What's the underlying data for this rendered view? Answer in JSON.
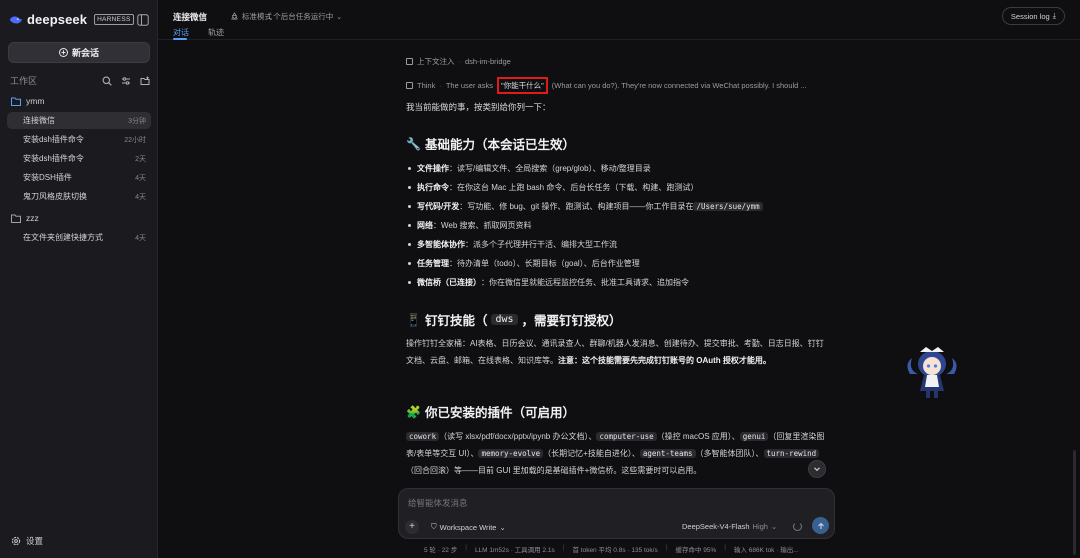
{
  "sidebar": {
    "brand": "deepseek",
    "badge": "HARNESS",
    "new_chat": "新会话",
    "workspace_title": "工作区",
    "folders": [
      {
        "name": "ymm",
        "threads": [
          {
            "title": "连接微信",
            "time": "3分钟",
            "active": true
          },
          {
            "title": "安装dsh插件命令",
            "time": "22小时"
          },
          {
            "title": "安装dsh插件命令",
            "time": "2天"
          },
          {
            "title": "安装DSH插件",
            "time": "4天"
          },
          {
            "title": "鬼刀风格皮肤切换",
            "time": "4天"
          }
        ]
      },
      {
        "name": "zzz",
        "threads": [
          {
            "title": "在文件夹创建快捷方式",
            "time": "4天"
          }
        ]
      }
    ],
    "settings": "设置"
  },
  "header": {
    "title": "连接微信",
    "mode": "标准模式",
    "tasks": "1 个后台任务运行中",
    "tabs": [
      "对话",
      "轨迹"
    ],
    "session_log": "Session log"
  },
  "conversation": {
    "context_label": "上下文注入",
    "context_value": "dsh-im-bridge",
    "think_label": "Think",
    "think_prefix": "The user asks",
    "think_quote": "\"你能干什么\"",
    "think_rest": "(What can you do?). They're now connected via WeChat possibly. I should ...",
    "intro": "我当前能做的事，按类别给你列一下：",
    "section1": {
      "emoji": "🔧",
      "title": "基础能力（本会话已生效）",
      "items": [
        {
          "label": "文件操作",
          "text": "：读写/编辑文件、全局搜索（grep/glob）、移动/整理目录"
        },
        {
          "label": "执行命令",
          "text": "：在你这台 Mac 上跑 bash 命令、后台长任务（下载、构建、跑测试）"
        },
        {
          "label": "写代码/开发",
          "text": "：写功能、修 bug、git 操作、跑测试、构建项目——你工作目录在 ",
          "code": "/Users/sue/ymm"
        },
        {
          "label": "网络",
          "text": "：Web 搜索、抓取网页资料"
        },
        {
          "label": "多智能体协作",
          "text": "：派多个子代理并行干活、编排大型工作流"
        },
        {
          "label": "任务管理",
          "text": "：待办清单（todo）、长期目标（goal）、后台作业管理"
        },
        {
          "label": "微信桥（已连接）",
          "text": "：你在微信里就能远程监控任务、批准工具请求、追加指令"
        }
      ]
    },
    "section2": {
      "emoji": "📱",
      "title_pre": "钉钉技能（",
      "title_code": "dws",
      "title_post": "，需要钉钉授权）",
      "para": "操作钉钉全家桶：AI表格、日历会议、通讯录查人、群聊/机器人发消息、创建待办、提交审批、考勤、日志日报、钉钉文档、云盘、邮箱、在线表格、知识库等。",
      "para_bold": "注意：这个技能需要先完成钉钉账号的 OAuth 授权才能用。"
    },
    "section3": {
      "emoji": "🧩",
      "title": "你已安装的插件（可启用）",
      "plugins": [
        {
          "code": "cowork",
          "text": "（读写 xlsx/pdf/docx/pptx/ipynb 办公文档）、"
        },
        {
          "code": "computer-use",
          "text": "（操控 macOS 应用）、"
        },
        {
          "code": "genui",
          "text": "（回复里渲染图表/表单等交互 UI）、"
        },
        {
          "code": "memory-evolve",
          "text": "（长期记忆+技能自进化）、"
        },
        {
          "code": "agent-teams",
          "text": "（多智能体团队）、"
        },
        {
          "code": "turn-rewind",
          "text": "（回合回滚）等——目前 GUI 里加载的是基础插件+微信桥。这些需要时可以启用。"
        }
      ]
    }
  },
  "input": {
    "placeholder": "给智能体发消息",
    "workspace": "Workspace Write",
    "model": "DeepSeek-V4-Flash",
    "level": "High"
  },
  "statusbar": [
    "5 轮 · 22 步",
    "LLM 1m52s · 工具调用 2.1s",
    "首 token 平均 0.8s · 135 tok/s",
    "缓存命中 95%",
    "输入 686K tok · 输出..."
  ]
}
